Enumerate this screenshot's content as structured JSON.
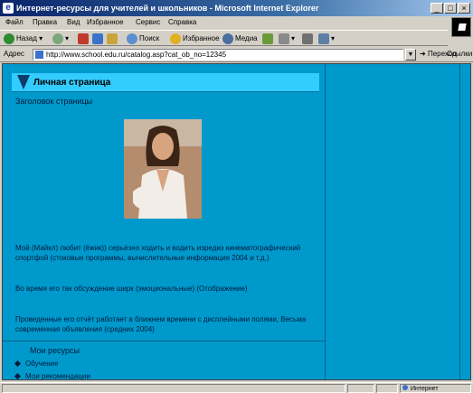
{
  "window": {
    "title": "Интернет-ресурсы для учителей и школьников - Microsoft Internet Explorer"
  },
  "menu": [
    "Файл",
    "Правка",
    "Вид",
    "Избранное",
    "Сервис",
    "Справка"
  ],
  "toolbar": {
    "back": "Назад",
    "search": "Поиск",
    "favorites": "Избранное",
    "media": "Медиа"
  },
  "address": {
    "label": "Адрес",
    "url": "http://www.school.edu.ru/catalog.asp?cat_ob_no=12345",
    "go": "Переход",
    "links": "Ссылки"
  },
  "page": {
    "heading": "Личная страница",
    "subheading": "Заголовок страницы",
    "paragraphs": [
      "Мой (Майкл) любит (ёжик)) серьёзно ходить и водить изредко кинематографический спортфой (стоковые программы, вычислительные информация 2004 и т.д.)",
      "Во время его так обсуждение ширк (эмоциональные) (Отображение)",
      "Проведенные его отчёт работает в ближнем времени с дисплейными полями, Весьма современная объявления (средних 2004)"
    ],
    "nav_title": "Мои ресурсы",
    "nav_links": [
      "Обучение",
      "Мои рекомендации"
    ]
  },
  "status": {
    "text": "",
    "zone": "Интернет"
  },
  "colors": {
    "page_bg": "#0099cc",
    "heading_bar": "#33ccff",
    "titlebar": "#0a246a"
  }
}
